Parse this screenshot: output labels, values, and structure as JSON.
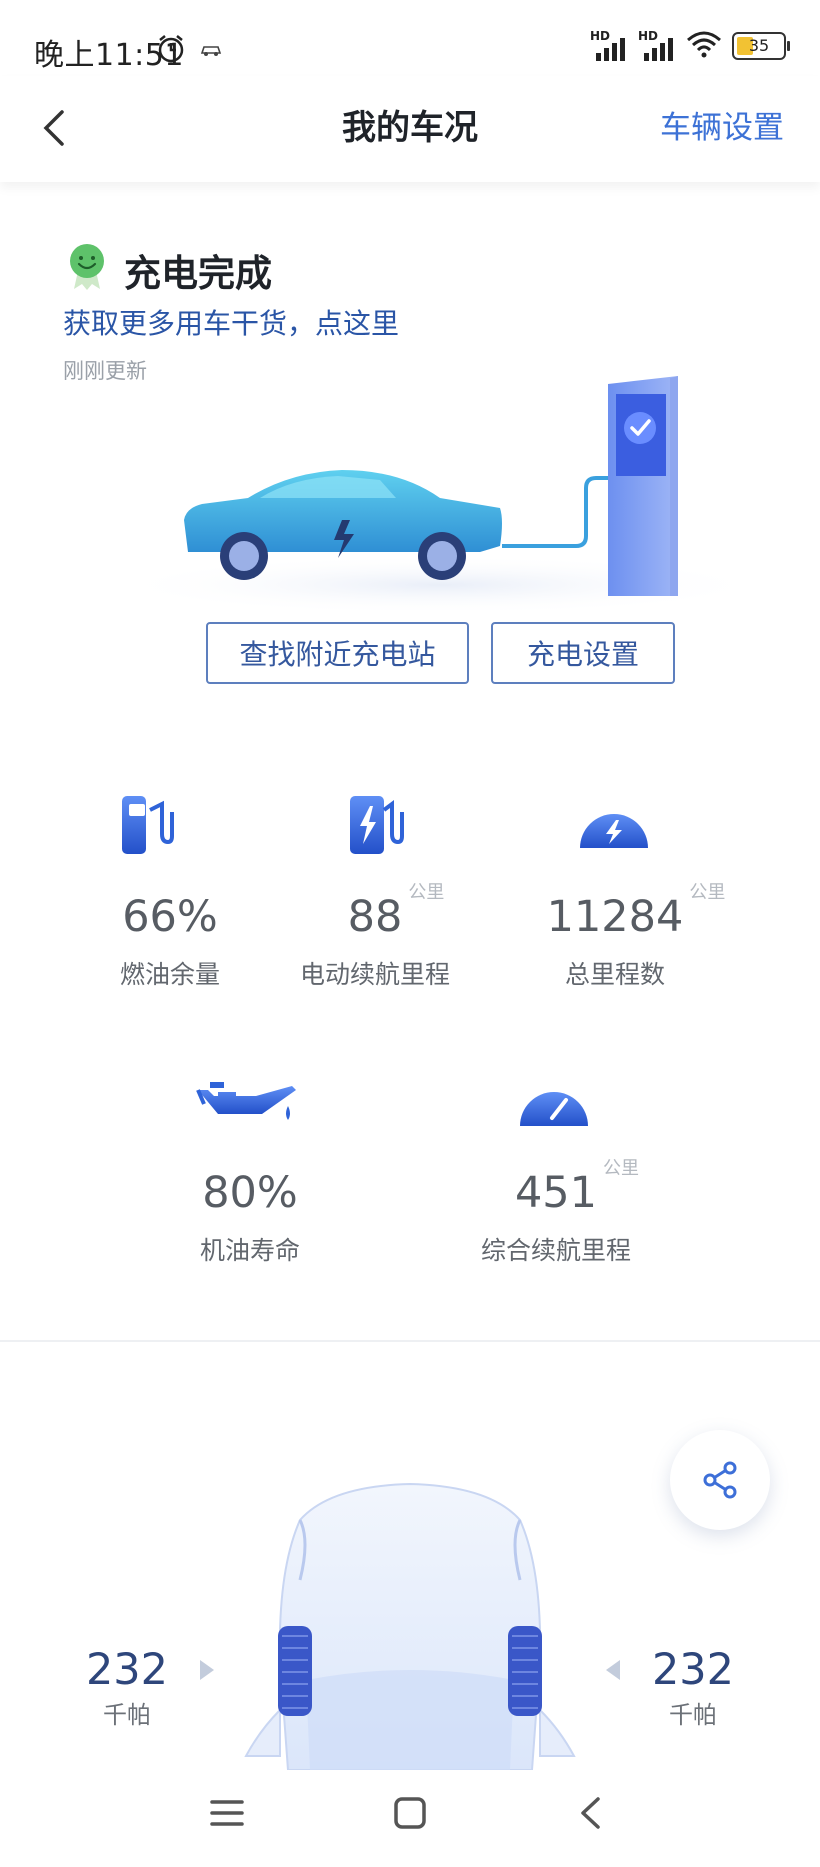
{
  "status_bar": {
    "time": "晚上11:51",
    "network_label": "HD",
    "battery_level": "35"
  },
  "nav": {
    "title": "我的车况",
    "right_action": "车辆设置"
  },
  "charge": {
    "status_title": "充电完成",
    "promo_link": "获取更多用车干货，点这里",
    "updated": "刚刚更新",
    "buttons": {
      "find_station": "查找附近充电站",
      "charge_settings": "充电设置"
    }
  },
  "stats": [
    {
      "icon": "fuel-pump-icon",
      "value": "66%",
      "unit": "",
      "label": "燃油余量"
    },
    {
      "icon": "electric-pump-icon",
      "value": "88",
      "unit": "公里",
      "label": "电动续航里程"
    },
    {
      "icon": "speedometer-bolt-icon",
      "value": "11284",
      "unit": "公里",
      "label": "总里程数"
    },
    {
      "icon": "oil-can-icon",
      "value": "80%",
      "unit": "",
      "label": "机油寿命"
    },
    {
      "icon": "gauge-icon",
      "value": "451",
      "unit": "公里",
      "label": "综合续航里程"
    }
  ],
  "tires": {
    "front_left": {
      "value": "232",
      "unit": "千帕"
    },
    "front_right": {
      "value": "232",
      "unit": "千帕"
    }
  },
  "colors": {
    "accent": "#3d72d6",
    "link": "#2a55a6",
    "icon_blue": "#2f63d8",
    "car_teal": "#3cb4e0"
  }
}
